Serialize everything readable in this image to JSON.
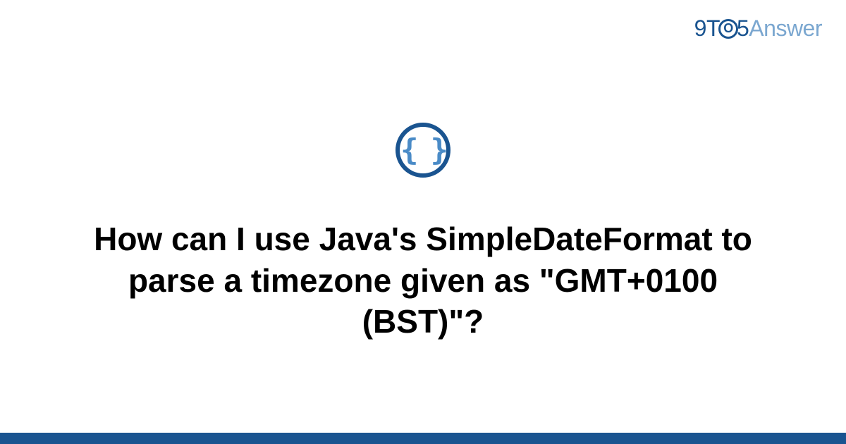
{
  "logo": {
    "part1": "9T",
    "circle_inner": "O",
    "part2": "5",
    "part3": "Answer"
  },
  "icon": {
    "name": "code-braces-icon",
    "glyph": "{ }"
  },
  "question": {
    "title": "How can I use Java's SimpleDateFormat to parse a timezone given as \"GMT+0100 (BST)\"?"
  },
  "colors": {
    "brand_primary": "#1a5490",
    "brand_light": "#7ba7d0",
    "icon_fill": "#4a8bc7"
  }
}
